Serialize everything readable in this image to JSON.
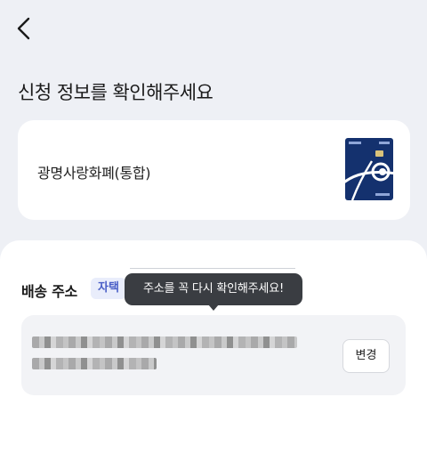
{
  "header": {
    "back_icon": "chevron-left-icon"
  },
  "page_title": "신청 정보를 확인해주세요",
  "card": {
    "name": "광명사랑화폐(통합)",
    "thumbnail_icon": "card-image",
    "colors": {
      "card_primary": "#14316e",
      "card_accent": "#ffffff"
    }
  },
  "address": {
    "heading": "배송 주소",
    "tag": "자택",
    "tooltip": "주소를 꼭 다시 확인해주세요!",
    "change_label": "변경"
  },
  "colors": {
    "background": "#eef0f5",
    "tag_bg": "#e9edfb",
    "tag_text": "#4a5fc7",
    "tooltip_bg": "#3a3d42"
  }
}
